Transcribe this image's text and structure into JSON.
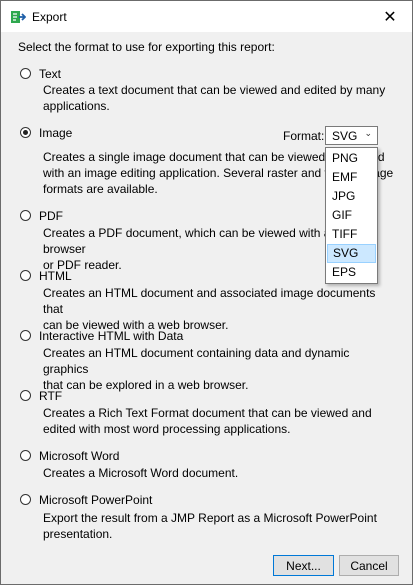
{
  "window": {
    "title": "Export",
    "close_glyph": "✕",
    "accent": "#2fa84f"
  },
  "prompt": "Select the format to use for exporting this report:",
  "options": [
    {
      "label": "Text",
      "selected": false,
      "desc": [
        "Creates a text document that can be viewed and edited by many",
        "applications."
      ]
    },
    {
      "label": "Image",
      "selected": true,
      "desc": [
        "Creates a single image document that can be viewed and edited",
        "with an image editing application. Several raster and vector image",
        "formats are available."
      ]
    },
    {
      "label": "PDF",
      "selected": false,
      "desc": [
        "Creates a PDF document, which can be viewed with a web browser",
        "or PDF reader."
      ]
    },
    {
      "label": "HTML",
      "selected": false,
      "desc": [
        "Creates an HTML document and associated image documents that",
        "can be viewed with a web browser."
      ]
    },
    {
      "label": "Interactive HTML with Data",
      "selected": false,
      "desc": [
        "Creates an HTML document containing data and dynamic graphics",
        "that can be explored in a web browser."
      ]
    },
    {
      "label": "RTF",
      "selected": false,
      "desc": [
        "Creates a Rich Text Format document that can be viewed and",
        "edited with most word processing applications."
      ]
    },
    {
      "label": "Microsoft Word",
      "selected": false,
      "desc": [
        "Creates a Microsoft Word document."
      ]
    },
    {
      "label": "Microsoft PowerPoint",
      "selected": false,
      "desc": [
        "Export the result from a JMP Report as a Microsoft PowerPoint",
        "presentation."
      ]
    }
  ],
  "format": {
    "label": "Format:",
    "value": "SVG",
    "options": [
      "PNG",
      "EMF",
      "JPG",
      "GIF",
      "TIFF",
      "SVG",
      "EPS"
    ],
    "highlighted": "SVG"
  },
  "buttons": {
    "next": "Next...",
    "cancel": "Cancel"
  }
}
